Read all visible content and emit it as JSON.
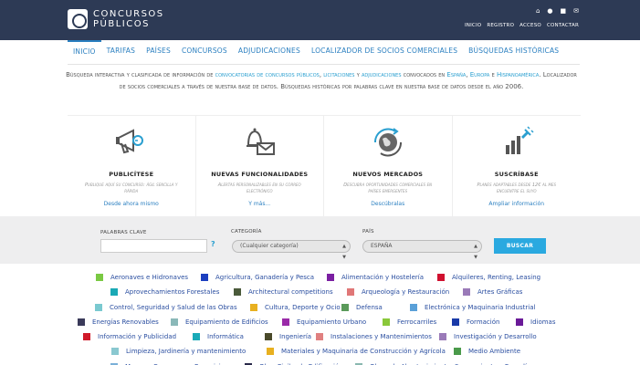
{
  "header": {
    "logo_line1": "CONCURSOS",
    "logo_line2": "PÚBLICOS",
    "icons": [
      "home-icon",
      "user-icon",
      "lock-icon",
      "mail-icon"
    ],
    "links": [
      "INICIO",
      "REGISTRO",
      "ACCESO",
      "CONTACTAR"
    ]
  },
  "nav": {
    "items": [
      "INICIO",
      "TARIFAS",
      "PAÍSES",
      "CONCURSOS",
      "ADJUDICACIONES",
      "LOCALIZADOR DE SOCIOS COMERCIALES",
      "BÚSQUEDAS HISTÓRICAS"
    ],
    "active": "INICIO"
  },
  "intro": {
    "p1": "Búsqueda interactiva y clasificada de información de ",
    "link1": "convocatorias de concursos públicos",
    "p2": ", ",
    "link2": "licitaciones",
    "p3": " y ",
    "link3": "adjudicaciones",
    "p4": " convocados en ",
    "link4": "España",
    "p5": ", ",
    "link5": "Europa",
    "p6": " e ",
    "link6": "Hispanoamérica",
    "p7": ". Localizador de socios comerciales a través de nuestra base de datos. Búsquedas históricas por palabras clave en nuestra base de datos desde el año 2006."
  },
  "features": [
    {
      "icon": "megaphone-icon",
      "title": "PUBLICÍTESE",
      "desc": "Publique aquí su concurso: ágil sencilla y rápida",
      "link": "Desde ahora mismo"
    },
    {
      "icon": "bell-envelope-icon",
      "title": "NUEVAS FUNCIONALIDADES",
      "desc": "Alertas personalizables en su correo electrónico",
      "link": "Y más..."
    },
    {
      "icon": "globe-icon",
      "title": "NUEVOS MERCADOS",
      "desc": "Descubra oportunidades comerciales en países emergentes",
      "link": "Descúbralas"
    },
    {
      "icon": "chart-plug-icon",
      "title": "SUSCRÍBASE",
      "desc": "Planes adaptables desde 12€ al mes encuentre el suyo",
      "link": "Ampliar información"
    }
  ],
  "search": {
    "keywords_label": "PALABRAS CLAVE",
    "keywords_value": "",
    "help": "?",
    "category_label": "CATEGORÍA",
    "category_value": "(Cualquier categoría)",
    "country_label": "PAÍS",
    "country_value": "ESPAÑA",
    "button": "BUSCAR"
  },
  "categories": [
    [
      {
        "t": "Aeronaves e Hidronaves",
        "c": "#7ac943"
      },
      {
        "t": "Agricultura, Ganadería y Pesca",
        "c": "#1c3fbf"
      },
      {
        "t": "Alimentación y Hostelería",
        "c": "#7b1fa2"
      },
      {
        "t": "Alquileres, Renting, Leasing",
        "c": "#d0102f"
      }
    ],
    [
      {
        "t": "Aprovechamientos Forestales",
        "c": "#1aa9b5"
      },
      {
        "t": "Architectural competitions",
        "c": "#4a5a3a"
      },
      {
        "t": "Arqueología y Restauración",
        "c": "#e07777"
      },
      {
        "t": "Artes Gráficas",
        "c": "#9a7ab8"
      }
    ],
    [
      {
        "t": "Control, Seguridad y Salud de las Obras",
        "c": "#7ac9d0"
      },
      {
        "t": "Cultura, Deporte y Ocio",
        "c": "#e8b020"
      },
      {
        "t": "Defensa",
        "c": "#5a9a5a"
      },
      {
        "t": "Electrónica y Maquinaria Industrial",
        "c": "#5aa0d8"
      }
    ],
    [
      {
        "t": "Energías Renovables",
        "c": "#3a3a5a"
      },
      {
        "t": "Equipamiento de Edificios",
        "c": "#8ab8b8"
      },
      {
        "t": "Equipamiento Urbano",
        "c": "#9a2aa8"
      },
      {
        "t": "Ferrocarriles",
        "c": "#8ac83a"
      },
      {
        "t": "Formación",
        "c": "#1a3aa8"
      },
      {
        "t": "Idiomas",
        "c": "#6a1a98"
      }
    ],
    [
      {
        "t": "Información y Publicidad",
        "c": "#d01a2a"
      },
      {
        "t": "Informática",
        "c": "#1aaab8"
      },
      {
        "t": "Ingeniería",
        "c": "#4a4a2a"
      },
      {
        "t": "Instalaciones y Mantenimientos",
        "c": "#e08080"
      },
      {
        "t": "Investigación y Desarrollo",
        "c": "#9a7ab8"
      }
    ],
    [
      {
        "t": "Limpieza, Jardinería y mantenimiento",
        "c": "#8ac8d0"
      },
      {
        "t": "Materiales y Maquinaria de Construcción y Agrícola",
        "c": "#e8b020"
      },
      {
        "t": "Medio Ambiente",
        "c": "#4a9a4a"
      }
    ],
    [
      {
        "t": "Museos, Congresos y Exposiciones",
        "c": "#7ab0d8"
      },
      {
        "t": "Obra Civil y de Edificación",
        "c": "#2a2a4a"
      },
      {
        "t": "Obras de Abastecimiento, Saneamiento y Regadío",
        "c": "#8ab8b0"
      }
    ]
  ]
}
